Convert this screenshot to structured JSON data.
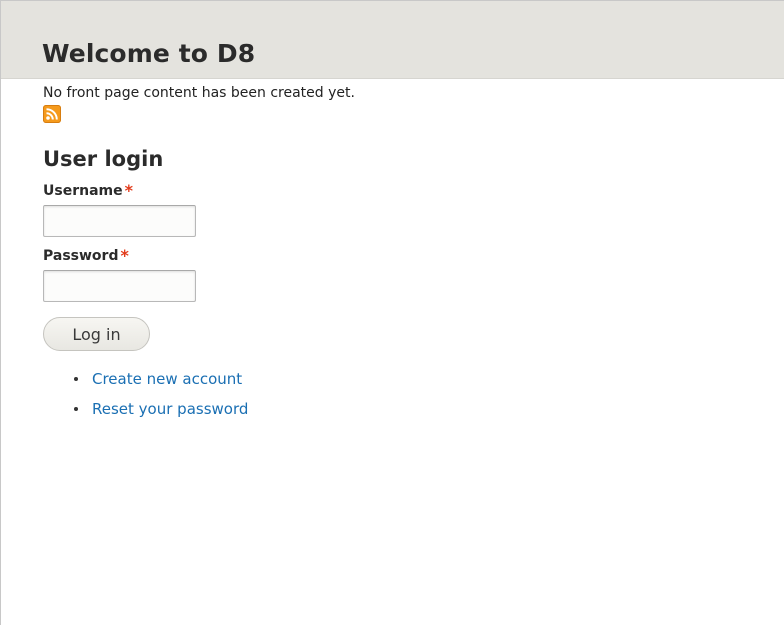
{
  "header": {
    "title": "Welcome to D8"
  },
  "front_page": {
    "empty_message": "No front page content has been created yet."
  },
  "feed_icon": {
    "icon": "rss-feed-icon",
    "color": "#f59a1c"
  },
  "login_block": {
    "title": "User login",
    "username_label": "Username",
    "password_label": "Password",
    "required_marker": "*",
    "username_value": "",
    "password_value": "",
    "submit_label": "Log in",
    "links": [
      {
        "label": "Create new account"
      },
      {
        "label": "Reset your password"
      }
    ]
  },
  "colors": {
    "header_bg": "#e4e3de",
    "link": "#1a6fb3",
    "required": "#e23a1a"
  }
}
